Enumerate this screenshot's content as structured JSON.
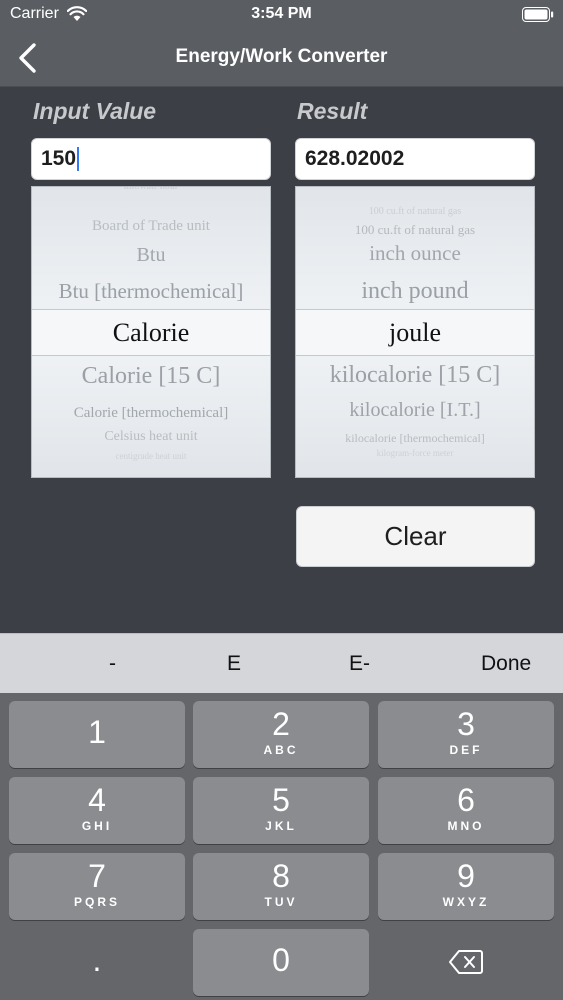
{
  "status_bar": {
    "carrier": "Carrier",
    "time": "3:54 PM"
  },
  "nav": {
    "title": "Energy/Work Converter"
  },
  "input": {
    "label": "Input Value",
    "value": "150",
    "picker": {
      "items": [
        "kilowatt-hour",
        "Board of Trade unit",
        "Btu",
        "Btu [thermochemical]",
        "Calorie",
        "Calorie [15 C]",
        "Calorie [thermochemical]",
        "Celsius heat unit",
        "centigrade heat unit"
      ],
      "selected": "Calorie"
    }
  },
  "result": {
    "label": "Result",
    "value": "628.02002",
    "picker": {
      "items": [
        "100 cu.ft of natural gas",
        "100 cu.ft of natural gas",
        "inch ounce",
        "inch pound",
        "joule",
        "kilocalorie [15 C]",
        "kilocalorie [I.T.]",
        "kilocalorie [thermochemical]",
        "kilogram-force meter"
      ],
      "selected": "joule"
    }
  },
  "clear_label": "Clear",
  "accessory": {
    "minus": "-",
    "e": "E",
    "e_minus": "E-",
    "done": "Done"
  },
  "keypad": {
    "keys": [
      {
        "digit": "1",
        "letters": ""
      },
      {
        "digit": "2",
        "letters": "ABC"
      },
      {
        "digit": "3",
        "letters": "DEF"
      },
      {
        "digit": "4",
        "letters": "GHI"
      },
      {
        "digit": "5",
        "letters": "JKL"
      },
      {
        "digit": "6",
        "letters": "MNO"
      },
      {
        "digit": "7",
        "letters": "PQRS"
      },
      {
        "digit": "8",
        "letters": "TUV"
      },
      {
        "digit": "9",
        "letters": "WXYZ"
      },
      {
        "digit": ".",
        "letters": ""
      },
      {
        "digit": "0",
        "letters": ""
      }
    ]
  },
  "colors": {
    "background": "#3c4046",
    "nav_bar": "#5a5e63",
    "caret": "#3478f6"
  }
}
